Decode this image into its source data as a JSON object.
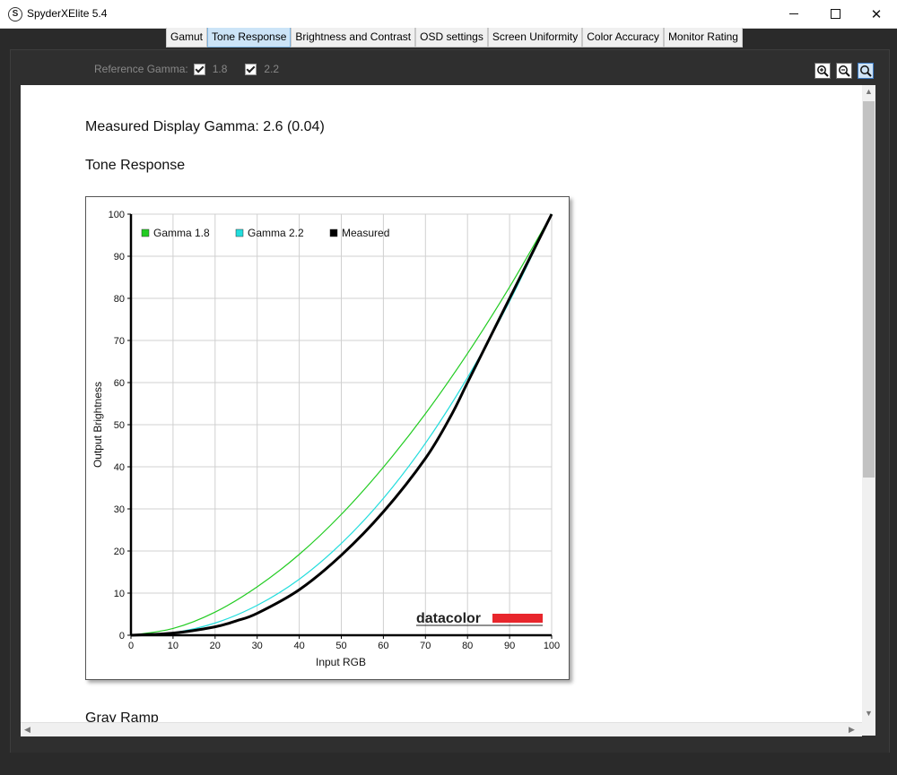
{
  "window": {
    "title": "SpyderXElite 5.4",
    "icon_letter": "S",
    "close_symbol": "✕"
  },
  "tabs": [
    {
      "label": "Gamut",
      "active": false
    },
    {
      "label": "Tone Response",
      "active": true
    },
    {
      "label": "Brightness and Contrast",
      "active": false
    },
    {
      "label": "OSD settings",
      "active": false
    },
    {
      "label": "Screen Uniformity",
      "active": false
    },
    {
      "label": "Color Accuracy",
      "active": false
    },
    {
      "label": "Monitor Rating",
      "active": false
    }
  ],
  "reference": {
    "label": "Reference Gamma:",
    "options": [
      {
        "label": "1.8",
        "checked": true
      },
      {
        "label": "2.2",
        "checked": true
      }
    ]
  },
  "zoom_controls": [
    "zoom-in-icon",
    "zoom-out-icon",
    "zoom-fit-icon"
  ],
  "report": {
    "measured_gamma": "Measured Display Gamma: 2.6 (0.04)",
    "section_title": "Tone Response",
    "next_section": "Gray Ramp"
  },
  "chart_data": {
    "type": "line",
    "xlabel": "Input RGB",
    "ylabel": "Output Brightness",
    "xlim": [
      0,
      100
    ],
    "ylim": [
      0,
      100
    ],
    "xticks": [
      0,
      10,
      20,
      30,
      40,
      50,
      60,
      70,
      80,
      90,
      100
    ],
    "yticks": [
      0,
      10,
      20,
      30,
      40,
      50,
      60,
      70,
      80,
      90,
      100
    ],
    "grid": true,
    "legend_placement": "top-left",
    "logo": "datacolor",
    "colors": {
      "gamma18": "#22cc22",
      "gamma22": "#22dddd",
      "measured": "#000000",
      "logo_bar": "#e8262c"
    },
    "series": [
      {
        "name": "Gamma 1.8",
        "color": "#22cc22",
        "x": [
          0,
          10,
          20,
          30,
          40,
          50,
          60,
          70,
          80,
          90,
          100
        ],
        "y": [
          0,
          1.6,
          5.5,
          11.5,
          19.2,
          28.7,
          39.9,
          52.6,
          66.9,
          82.7,
          100
        ]
      },
      {
        "name": "Gamma 2.2",
        "color": "#22dddd",
        "x": [
          0,
          10,
          20,
          30,
          40,
          50,
          60,
          70,
          80,
          90,
          100
        ],
        "y": [
          0,
          0.6,
          2.9,
          7.1,
          13.3,
          21.8,
          32.5,
          45.6,
          61.2,
          79.3,
          100
        ]
      },
      {
        "name": "Measured",
        "color": "#000000",
        "x": [
          0,
          10,
          20,
          25,
          30,
          40,
          50,
          60,
          70,
          76,
          80,
          85,
          90,
          100
        ],
        "y": [
          0,
          0.5,
          2.0,
          3.4,
          5.2,
          10.8,
          19.0,
          29.3,
          42.0,
          52.0,
          60.0,
          70.0,
          80.0,
          100
        ]
      }
    ]
  }
}
